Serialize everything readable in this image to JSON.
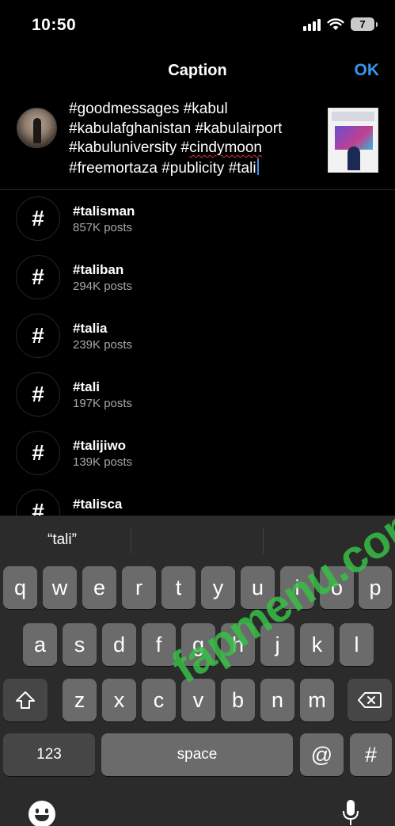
{
  "status_bar": {
    "time": "10:50",
    "battery": "7"
  },
  "header": {
    "title": "Caption",
    "ok_label": "OK"
  },
  "caption": {
    "lines": [
      "#goodmessages #kabul",
      "#kabulafghanistan #kabulairport",
      "#kabuluniversity #",
      "#freemortaza #publicity #tali"
    ],
    "misspelled_word": "cindymoon"
  },
  "suggestions": [
    {
      "tag": "#talisman",
      "count": "857K posts"
    },
    {
      "tag": "#taliban",
      "count": "294K posts"
    },
    {
      "tag": "#talia",
      "count": "239K posts"
    },
    {
      "tag": "#tali",
      "count": "197K posts"
    },
    {
      "tag": "#talijiwo",
      "count": "139K posts"
    },
    {
      "tag": "#talisca",
      "count": ""
    }
  ],
  "keyboard": {
    "prediction": "“tali”",
    "row1": [
      "q",
      "w",
      "e",
      "r",
      "t",
      "y",
      "u",
      "i",
      "o",
      "p"
    ],
    "row2": [
      "a",
      "s",
      "d",
      "f",
      "g",
      "h",
      "j",
      "k",
      "l"
    ],
    "row3": [
      "z",
      "x",
      "c",
      "v",
      "b",
      "n",
      "m"
    ],
    "numbers_label": "123",
    "space_label": "space",
    "at_label": "@",
    "hash_label": "#"
  },
  "watermark": "fapmenu.com",
  "colors": {
    "accent": "#3797f0",
    "background": "#000000",
    "keyboard": "#2b2b2b"
  }
}
